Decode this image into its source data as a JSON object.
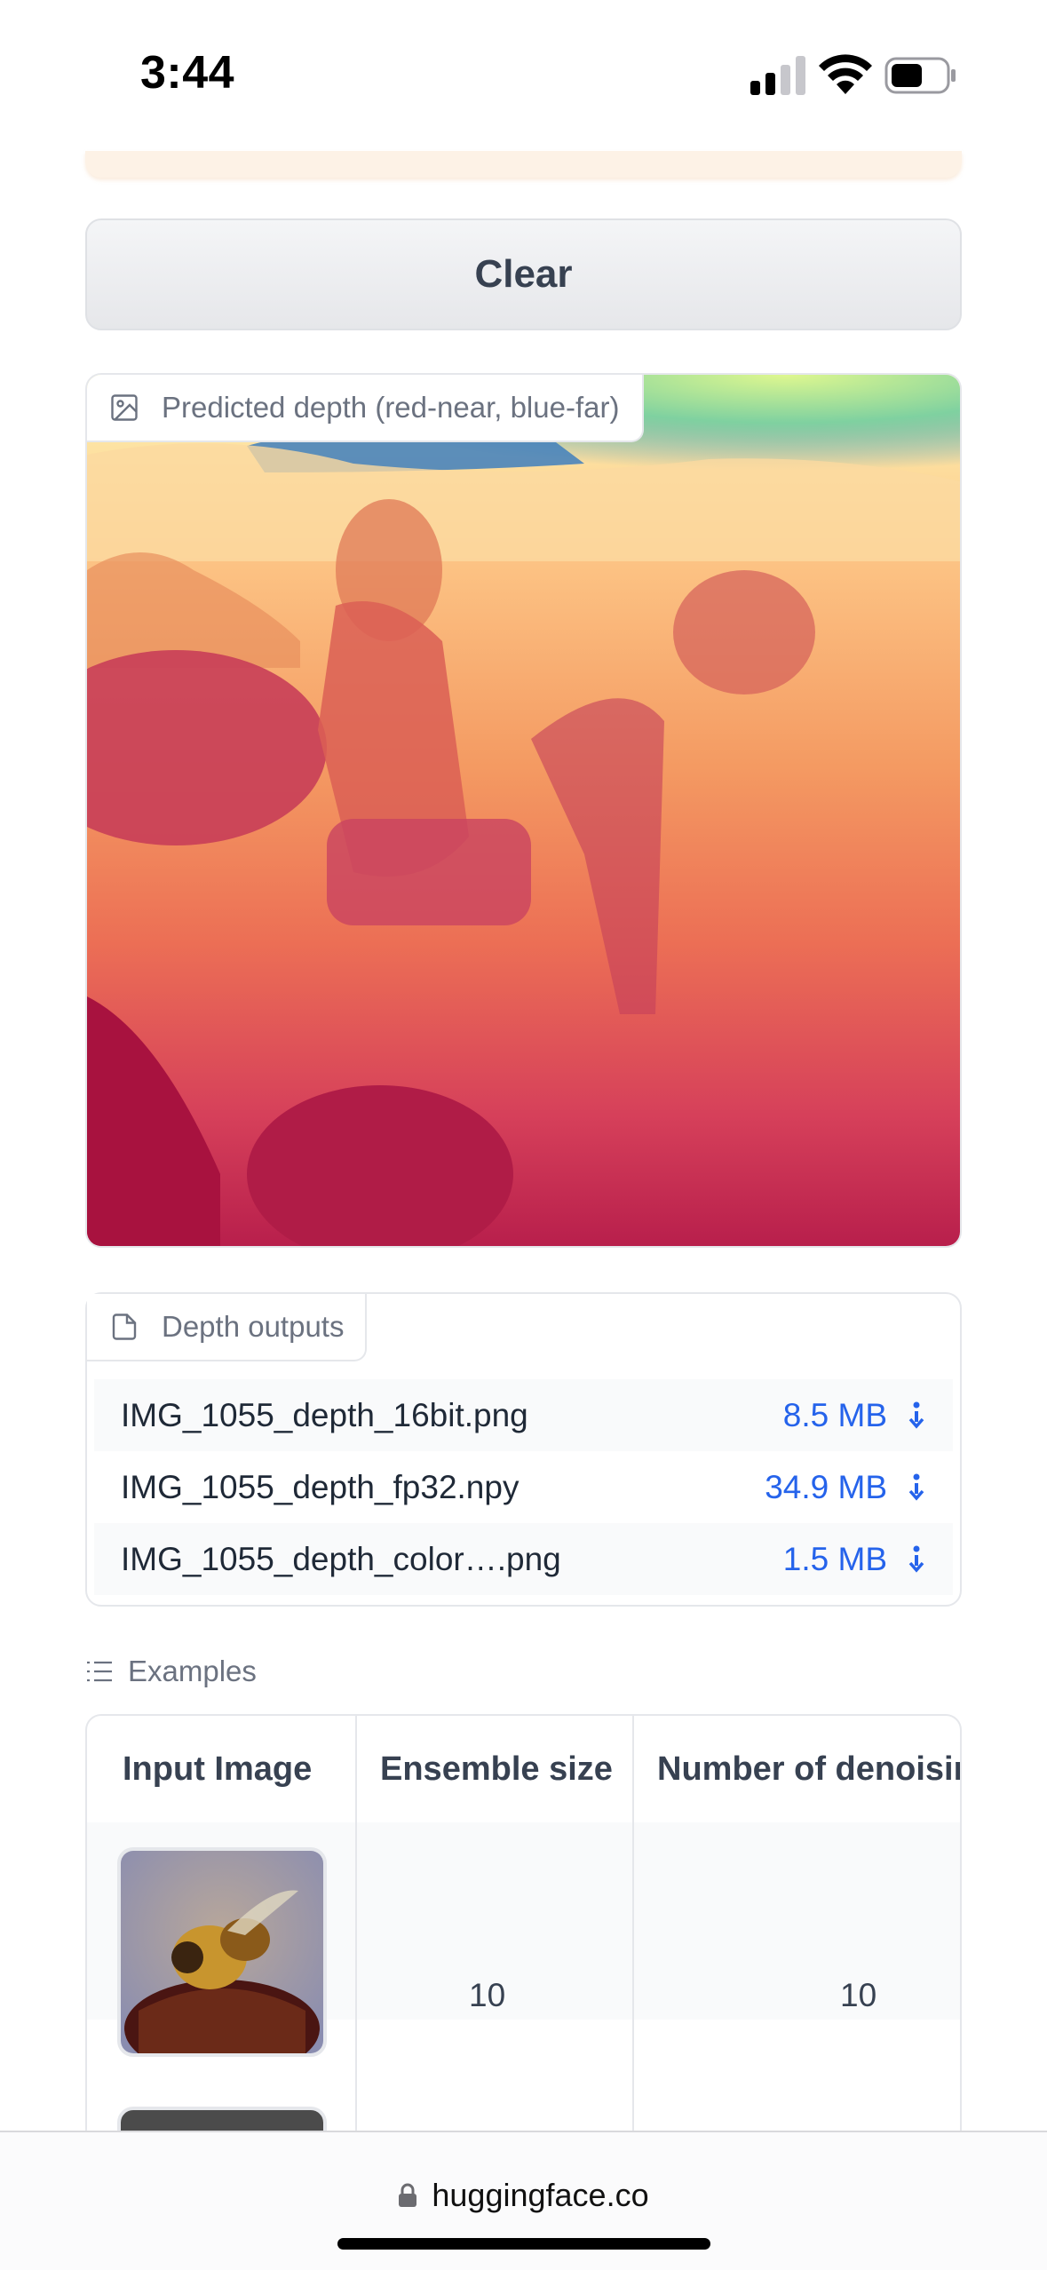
{
  "status_bar": {
    "time": "3:44",
    "icons": [
      "cellular-signal-icon",
      "wifi-icon",
      "battery-icon"
    ]
  },
  "clear_button": {
    "label": "Clear"
  },
  "depth_image": {
    "label": "Predicted depth (red-near, blue-far)",
    "icon": "image-icon"
  },
  "depth_outputs": {
    "label": "Depth outputs",
    "icon": "file-icon",
    "files": [
      {
        "name": "IMG_1055_depth_16bit.png",
        "size": "8.5 MB"
      },
      {
        "name": "IMG_1055_depth_fp32.npy",
        "size": "34.9 MB"
      },
      {
        "name": "IMG_1055_depth_color….png",
        "size": "1.5 MB"
      }
    ]
  },
  "examples": {
    "label": "Examples",
    "icon": "list-icon",
    "columns": [
      "Input Image",
      "Ensemble size",
      "Number of denoisir"
    ],
    "rows": [
      {
        "image": "bee-on-flower-thumbnail",
        "ensemble_size": "10",
        "denoising_steps": "10"
      }
    ]
  },
  "browser": {
    "url": "huggingface.co"
  },
  "colors": {
    "accent_blue": "#2563eb",
    "label_gray": "#6b7280",
    "border": "#e5e7eb"
  }
}
